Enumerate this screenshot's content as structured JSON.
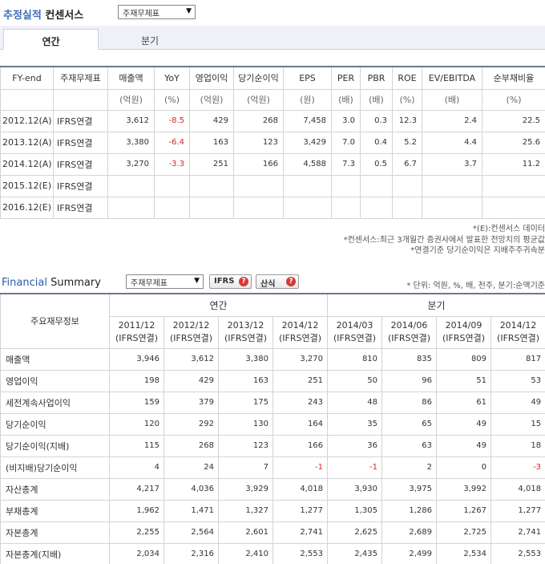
{
  "header": {
    "title_part1": "추정실적",
    "title_part2": "컨센서스",
    "select_value": "주재무제표"
  },
  "tabs": [
    {
      "label": "연간",
      "active": true
    },
    {
      "label": "분기",
      "active": false
    }
  ],
  "consensus": {
    "columns": [
      "FY-end",
      "주재무제표",
      "매출액",
      "YoY",
      "영업이익",
      "당기순이익",
      "EPS",
      "PER",
      "PBR",
      "ROE",
      "EV/EBITDA",
      "순부채비율"
    ],
    "units": [
      "",
      "",
      "(억원)",
      "(%)",
      "(억원)",
      "(억원)",
      "(원)",
      "(배)",
      "(배)",
      "(%)",
      "(배)",
      "(%)"
    ],
    "rows": [
      {
        "fy": "2012.12(A)",
        "acc": "IFRS연결",
        "values": [
          "3,612",
          "-8.5",
          "429",
          "268",
          "7,458",
          "3.0",
          "0.3",
          "12.3",
          "2.4",
          "22.5"
        ]
      },
      {
        "fy": "2013.12(A)",
        "acc": "IFRS연결",
        "values": [
          "3,380",
          "-6.4",
          "163",
          "123",
          "3,429",
          "7.0",
          "0.4",
          "5.2",
          "4.4",
          "25.6"
        ]
      },
      {
        "fy": "2014.12(A)",
        "acc": "IFRS연결",
        "values": [
          "3,270",
          "-3.3",
          "251",
          "166",
          "4,588",
          "7.3",
          "0.5",
          "6.7",
          "3.7",
          "11.2"
        ]
      },
      {
        "fy": "2015.12(E)",
        "acc": "IFRS연결",
        "values": [
          "",
          "",
          "",
          "",
          "",
          "",
          "",
          "",
          "",
          ""
        ]
      },
      {
        "fy": "2016.12(E)",
        "acc": "IFRS연결",
        "values": [
          "",
          "",
          "",
          "",
          "",
          "",
          "",
          "",
          "",
          ""
        ]
      }
    ],
    "notes": [
      "*(E):컨센서스 데이터",
      "*컨센서스:최근 3개월간 증권사에서 발표한 전망치의 평균값",
      "*연결기준 당기순이익은 지배주주귀속분"
    ]
  },
  "summary": {
    "title_part1": "Financial",
    "title_part2": "Summary",
    "select_value": "주재무제표",
    "ifrs_button": "IFRS",
    "calc_button": "산식",
    "help_icon": "question-icon",
    "unit_note": "* 단위: 억원, %, 배, 천주, 분기:순액기준",
    "row_head": "주요재무정보",
    "group_annual": "연간",
    "group_quarter": "분기",
    "periods": [
      {
        "date": "2011/12",
        "acc": "(IFRS연결)"
      },
      {
        "date": "2012/12",
        "acc": "(IFRS연결)"
      },
      {
        "date": "2013/12",
        "acc": "(IFRS연결)"
      },
      {
        "date": "2014/12",
        "acc": "(IFRS연결)"
      },
      {
        "date": "2014/03",
        "acc": "(IFRS연결)"
      },
      {
        "date": "2014/06",
        "acc": "(IFRS연결)"
      },
      {
        "date": "2014/09",
        "acc": "(IFRS연결)"
      },
      {
        "date": "2014/12",
        "acc": "(IFRS연결)"
      }
    ],
    "rows": [
      {
        "label": "매출액",
        "values": [
          "3,946",
          "3,612",
          "3,380",
          "3,270",
          "810",
          "835",
          "809",
          "817"
        ]
      },
      {
        "label": "영업이익",
        "values": [
          "198",
          "429",
          "163",
          "251",
          "50",
          "96",
          "51",
          "53"
        ]
      },
      {
        "label": "세전계속사업이익",
        "values": [
          "159",
          "379",
          "175",
          "243",
          "48",
          "86",
          "61",
          "49"
        ]
      },
      {
        "label": "당기순이익",
        "values": [
          "120",
          "292",
          "130",
          "164",
          "35",
          "65",
          "49",
          "15"
        ]
      },
      {
        "label": "당기순이익(지배)",
        "values": [
          "115",
          "268",
          "123",
          "166",
          "36",
          "63",
          "49",
          "18"
        ]
      },
      {
        "label": "(비지배)당기순이익",
        "values": [
          "4",
          "24",
          "7",
          "-1",
          "-1",
          "2",
          "0",
          "-3"
        ]
      },
      {
        "label": "자산총계",
        "values": [
          "4,217",
          "4,036",
          "3,929",
          "4,018",
          "3,930",
          "3,975",
          "3,992",
          "4,018"
        ]
      },
      {
        "label": "부채총계",
        "values": [
          "1,962",
          "1,471",
          "1,327",
          "1,277",
          "1,305",
          "1,286",
          "1,267",
          "1,277"
        ]
      },
      {
        "label": "자본총계",
        "values": [
          "2,255",
          "2,564",
          "2,601",
          "2,741",
          "2,625",
          "2,689",
          "2,725",
          "2,741"
        ]
      },
      {
        "label": "자본총계(지배)",
        "values": [
          "2,034",
          "2,316",
          "2,410",
          "2,553",
          "2,435",
          "2,499",
          "2,534",
          "2,553"
        ]
      }
    ]
  },
  "colors": {
    "accent": "#3d6fb6",
    "negative": "#d6252b",
    "help": "#d63b2f"
  }
}
